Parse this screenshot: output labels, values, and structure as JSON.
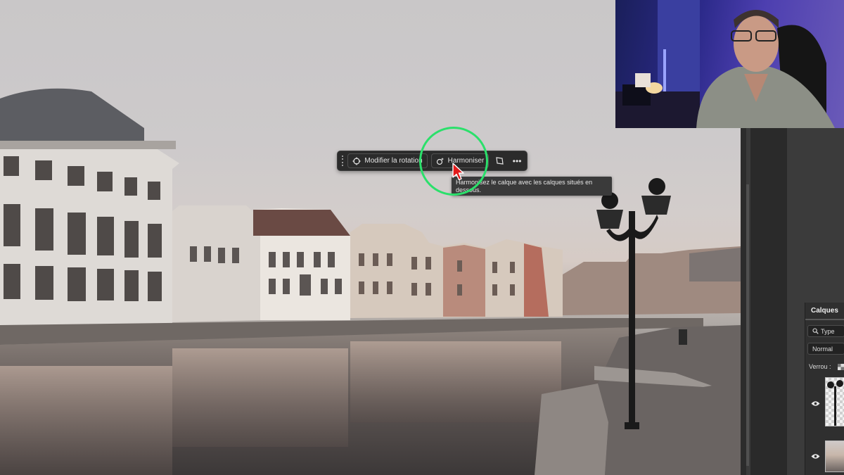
{
  "taskbar": {
    "rotate_label": "Modifier la rotation",
    "harmonize_label": "Harmoniser",
    "more_label": "•••"
  },
  "tooltip": {
    "text": "Harmonisez le calque avec les calques situés en dessous."
  },
  "layers_panel": {
    "title": "Calques",
    "filter_label": "Type",
    "blend_mode": "Normal",
    "lock_label": "Verrou :"
  },
  "colors": {
    "highlight": "#2be06b",
    "cursor": "#e21b1b",
    "panel_bg": "#2f2f2f",
    "taskbar_bg": "#2b2b2b"
  },
  "icons": [
    "grip-icon",
    "rotate-icon",
    "harmonize-icon",
    "crop-icon",
    "more-icon",
    "search-icon",
    "eye-icon",
    "transparency-icon"
  ]
}
